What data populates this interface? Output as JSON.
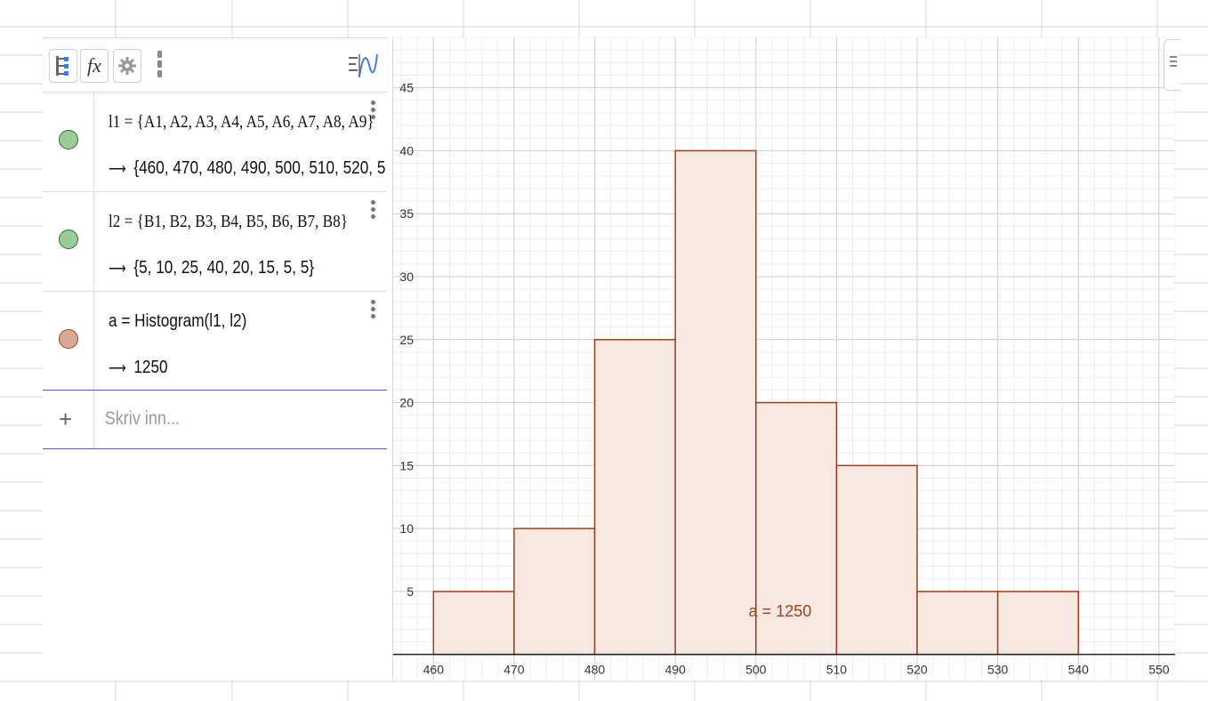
{
  "algebra": {
    "rows": [
      {
        "definition": "l1 = {A1, A2, A3, A4, A5, A6, A7, A8, A9}",
        "output": "{460, 470, 480, 490, 500, 510, 520, 5",
        "marble_color": "#99cc99"
      },
      {
        "definition": "l2 = {B1, B2, B3, B4, B5, B6, B7, B8}",
        "output": "{5, 10, 25, 40, 20, 15, 5, 5}",
        "marble_color": "#99cc99"
      },
      {
        "definition": "a = Histogram(l1, l2)",
        "output": "1250",
        "marble_color": "#dca896"
      }
    ],
    "input_placeholder": "Skriv inn..."
  },
  "toolbar": {
    "fx_label": "fx"
  },
  "icons": {
    "algebra_view": "tree-view-icon",
    "function": "fx-icon",
    "settings": "gear-icon",
    "more": "more-vertical-icon",
    "graph_toggle": "graph-view-icon",
    "add": "plus-icon",
    "row_menu": "more-vertical-icon"
  },
  "colors": {
    "histogram_stroke": "#a0401a",
    "histogram_fill": "#f7e8e2",
    "label": "#a0401a",
    "input_border": "#6557d2"
  },
  "chart_data": {
    "type": "bar",
    "bin_edges": [
      460,
      470,
      480,
      490,
      500,
      510,
      520,
      530,
      540
    ],
    "values": [
      5,
      10,
      25,
      40,
      20,
      15,
      5,
      5
    ],
    "xlim": [
      455,
      552
    ],
    "ylim": [
      -2,
      49
    ],
    "x_ticks": [
      460,
      470,
      480,
      490,
      500,
      510,
      520,
      530,
      540,
      550
    ],
    "y_ticks": [
      5,
      10,
      15,
      20,
      25,
      30,
      35,
      40,
      45
    ],
    "grid": true,
    "annotation": "a = 1250",
    "annotation_x": 503,
    "annotation_y": 3
  }
}
